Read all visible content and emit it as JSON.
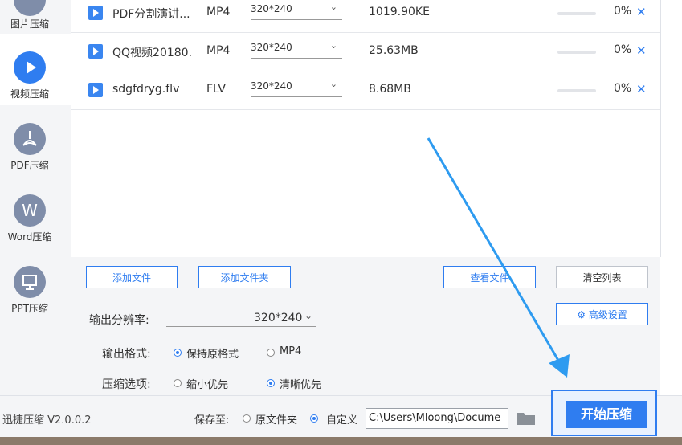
{
  "sidebar": {
    "items": [
      {
        "label": "图片压缩",
        "icon": "image-icon"
      },
      {
        "label": "视频压缩",
        "icon": "play-icon",
        "active": true
      },
      {
        "label": "PDF压缩",
        "icon": "pdf-icon"
      },
      {
        "label": "Word压缩",
        "icon": "word-icon",
        "glyph": "W"
      },
      {
        "label": "PPT压缩",
        "icon": "ppt-icon"
      }
    ]
  },
  "files": [
    {
      "name": "PDF分割演讲...",
      "format": "MP4",
      "resolution": "320*240",
      "size": "1019.90KE",
      "progress": "0%"
    },
    {
      "name": "QQ视频20180...",
      "format": "MP4",
      "resolution": "320*240",
      "size": "25.63MB",
      "progress": "0%"
    },
    {
      "name": "sdgfdryg.flv",
      "format": "FLV",
      "resolution": "320*240",
      "size": "8.68MB",
      "progress": "0%"
    }
  ],
  "buttons": {
    "add_file": "添加文件",
    "add_folder": "添加文件夹",
    "view_file": "查看文件",
    "clear_list": "清空列表",
    "advanced": "高级设置",
    "start": "开始压缩"
  },
  "settings": {
    "resolution_label": "输出分辨率:",
    "resolution_value": "320*240",
    "format_label": "输出格式:",
    "format_keep": "保持原格式",
    "format_mp4": "MP4",
    "compress_label": "压缩选项:",
    "compress_small": "缩小优先",
    "compress_clear": "清晰优先"
  },
  "footer": {
    "version": "迅捷压缩 V2.0.0.2",
    "save_to": "保存至:",
    "original_folder": "原文件夹",
    "custom": "自定义",
    "path": "C:\\Users\\Mloong\\Docume"
  },
  "colors": {
    "accent": "#2f7df0",
    "annotation_arrow": "#2e9bf0"
  }
}
